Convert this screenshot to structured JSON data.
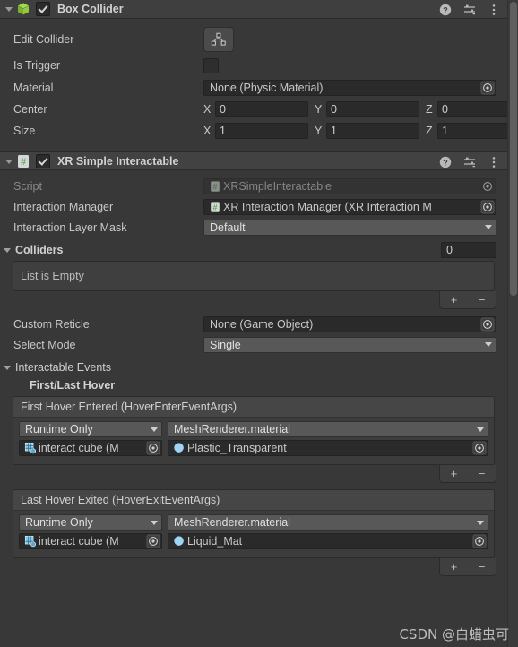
{
  "box_collider": {
    "title": "Box Collider",
    "icon": "box-collider-cube-icon",
    "enabled_checkbox": true,
    "help_icon": "help-icon",
    "preset_icon": "preset-settings-icon",
    "menu_icon": "more-menu-icon",
    "edit_collider": {
      "label": "Edit Collider",
      "button_icon": "edit-collider-polygon-icon"
    },
    "is_trigger": {
      "label": "Is Trigger",
      "value": false
    },
    "material": {
      "label": "Material",
      "value": "None (Physic Material)",
      "picker_icon": "object-picker-icon"
    },
    "center": {
      "label": "Center",
      "axes": [
        "X",
        "Y",
        "Z"
      ],
      "values": [
        "0",
        "0",
        "0"
      ]
    },
    "size": {
      "label": "Size",
      "axes": [
        "X",
        "Y",
        "Z"
      ],
      "values": [
        "1",
        "1",
        "1"
      ]
    }
  },
  "xr_simple_interactable": {
    "title": "XR Simple Interactable",
    "icon": "cs-script-icon",
    "enabled_checkbox": true,
    "help_icon": "help-icon",
    "preset_icon": "preset-settings-icon",
    "menu_icon": "more-menu-icon",
    "script": {
      "label": "Script",
      "value": "XRSimpleInteractable",
      "icon": "cs-script-icon",
      "picker_icon": "object-picker-icon",
      "disabled": true
    },
    "interaction_manager": {
      "label": "Interaction Manager",
      "value": "XR Interaction Manager (XR Interaction M",
      "icon": "cs-script-icon",
      "picker_icon": "object-picker-icon"
    },
    "interaction_layer_mask": {
      "label": "Interaction Layer Mask",
      "value": "Default"
    },
    "colliders": {
      "label": "Colliders",
      "size": "0",
      "empty_text": "List is Empty",
      "add_label": "+",
      "remove_label": "−"
    },
    "custom_reticle": {
      "label": "Custom Reticle",
      "value": "None (Game Object)",
      "picker_icon": "object-picker-icon"
    },
    "select_mode": {
      "label": "Select Mode",
      "value": "Single"
    },
    "interactable_events": {
      "label": "Interactable Events",
      "group_label": "First/Last Hover",
      "add_label": "+",
      "remove_label": "−",
      "events": [
        {
          "header": "First Hover Entered (HoverEnterEventArgs)",
          "call_state": "Runtime Only",
          "function": "MeshRenderer.material",
          "target_object": "interact cube (M",
          "target_icon": "mesh-renderer-icon",
          "argument_value": "Plastic_Transparent",
          "argument_icon": "material-sphere-icon",
          "picker_icon": "object-picker-icon"
        },
        {
          "header": "Last Hover Exited (HoverExitEventArgs)",
          "call_state": "Runtime Only",
          "function": "MeshRenderer.material",
          "target_object": "interact cube (M",
          "target_icon": "mesh-renderer-icon",
          "argument_value": "Liquid_Mat",
          "argument_icon": "material-sphere-icon",
          "picker_icon": "object-picker-icon"
        }
      ]
    }
  },
  "watermark": {
    "text": "CSDN @白蜡虫可"
  },
  "colors": {
    "background": "#383838",
    "header": "#3f3f3f",
    "field": "#2a2a2a",
    "dropdown": "#585858",
    "accent_green": "#8cc63f",
    "accent_blue": "#6ab0e0"
  }
}
